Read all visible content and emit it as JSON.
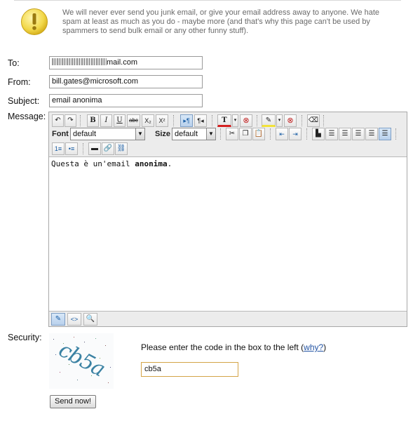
{
  "notice": "We will never ever send you junk email, or give your email address away to anyone. We hate spam at least as much as you do - maybe more (and that's why this page can't be used by spammers to send bulk email or any other funny stuff).",
  "form": {
    "to_label": "To:",
    "to_visible_suffix": "mail.com",
    "from_label": "From:",
    "from_value": "bill.gates@microsoft.com",
    "subject_label": "Subject:",
    "subject_value": "email anonima",
    "message_label": "Message:"
  },
  "toolbar": {
    "font_label": "Font",
    "font_value": "default",
    "size_label": "Size",
    "size_value": "default",
    "bold": "B",
    "italic": "I",
    "underline": "U",
    "strike": "abc",
    "subscript": "X₂",
    "superscript": "X²",
    "text_color": "T"
  },
  "message": {
    "text_plain": "Questa è un'email ",
    "text_bold": "anonima",
    "text_end": "."
  },
  "security": {
    "label": "Security:",
    "captcha_text": "cb5a",
    "prompt": "Please enter the code in the box to the left (",
    "why_link": "why?",
    "prompt_end": ")",
    "code_value": "cb5a"
  },
  "send_button": "Send now!",
  "colors": {
    "link": "#2354a4",
    "captcha_text": "#3b82a3",
    "input_focus_border": "#d4a448"
  }
}
